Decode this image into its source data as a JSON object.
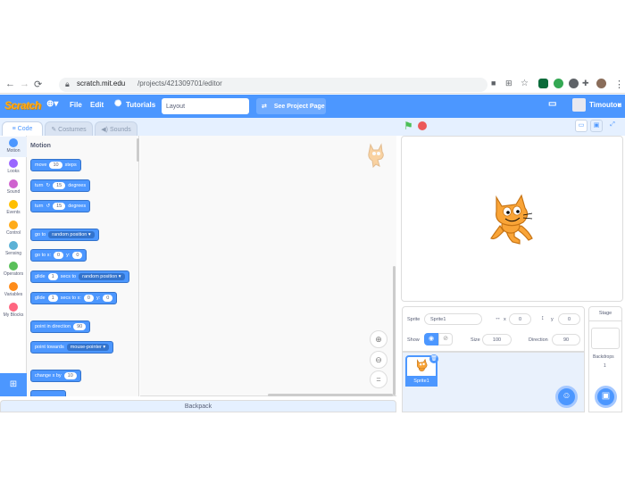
{
  "browser": {
    "url_host": "scratch.mit.edu",
    "url_path": "/projects/421309701/editor"
  },
  "menubar": {
    "logo": "Scratch",
    "file": "File",
    "edit": "Edit",
    "tutorials": "Tutorials",
    "project_title": "Layout",
    "see_project": "See Project Page",
    "username": "Timoutou"
  },
  "tabs": {
    "code": "Code",
    "costumes": "Costumes",
    "sounds": "Sounds"
  },
  "categories": [
    {
      "label": "Motion",
      "color": "#4c97ff"
    },
    {
      "label": "Looks",
      "color": "#9966ff"
    },
    {
      "label": "Sound",
      "color": "#cf63cf"
    },
    {
      "label": "Events",
      "color": "#ffbf00"
    },
    {
      "label": "Control",
      "color": "#ffab19"
    },
    {
      "label": "Sensing",
      "color": "#5cb1d6"
    },
    {
      "label": "Operators",
      "color": "#59c059"
    },
    {
      "label": "Variables",
      "color": "#ff8c1a"
    },
    {
      "label": "My Blocks",
      "color": "#ff6680"
    }
  ],
  "palette": {
    "heading": "Motion",
    "move": {
      "a": "move",
      "n": "10",
      "b": "steps"
    },
    "turn_right": {
      "a": "turn",
      "icon": "↻",
      "n": "15",
      "b": "degrees"
    },
    "turn_left": {
      "a": "turn",
      "icon": "↺",
      "n": "15",
      "b": "degrees"
    },
    "goto": {
      "a": "go to",
      "d": "random position ▾"
    },
    "gotoxy": {
      "a": "go to x:",
      "x": "0",
      "b": "y:",
      "y": "0"
    },
    "glide_to": {
      "a": "glide",
      "n": "1",
      "b": "secs to",
      "d": "random position ▾"
    },
    "glide_xy": {
      "a": "glide",
      "n": "1",
      "b": "secs to x:",
      "x": "0",
      "c": "y:",
      "y": "0"
    },
    "point_dir": {
      "a": "point in direction",
      "n": "90"
    },
    "point_towards": {
      "a": "point towards",
      "d": "mouse-pointer ▾"
    },
    "change_x": {
      "a": "change x by",
      "n": "10"
    }
  },
  "backpack": "Backpack",
  "sprite_info": {
    "sprite_label": "Sprite",
    "sprite_name": "Sprite1",
    "x_label": "x",
    "x": "0",
    "y_label": "y",
    "y": "0",
    "show_label": "Show",
    "size_label": "Size",
    "size": "100",
    "direction_label": "Direction",
    "direction": "90"
  },
  "sprite_list": [
    {
      "name": "Sprite1"
    }
  ],
  "stage_pane": {
    "title": "Stage",
    "backdrops_label": "Backdrops",
    "backdrops_count": "1"
  }
}
